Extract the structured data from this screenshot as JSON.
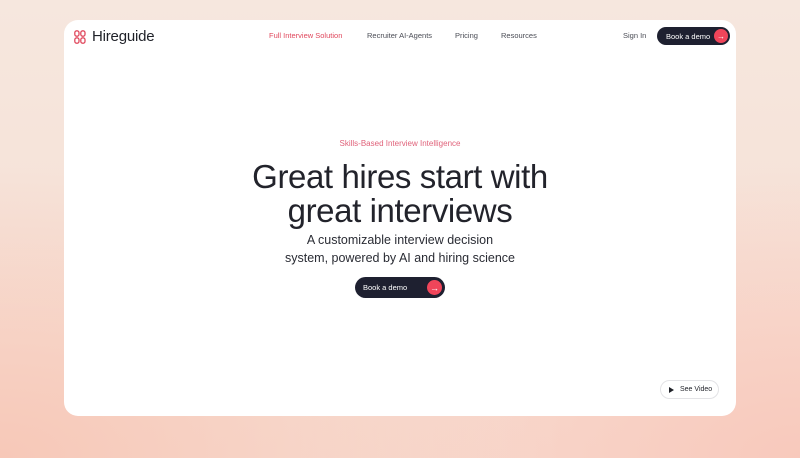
{
  "brand": {
    "name": "Hireguide",
    "accent": "#f0455a",
    "dark": "#1e2030"
  },
  "nav": {
    "links": [
      {
        "label": "Full Interview Solution",
        "active": true
      },
      {
        "label": "Recruiter AI-Agents",
        "active": false
      },
      {
        "label": "Pricing",
        "active": false
      },
      {
        "label": "Resources",
        "active": false
      }
    ],
    "sign_in": "Sign In",
    "cta": "Book a demo"
  },
  "hero": {
    "eyebrow": "Skills-Based Interview Intelligence",
    "headline_line1": "Great hires start with",
    "headline_line2": "great interviews",
    "subhead_line1": "A customizable interview decision",
    "subhead_line2": "system, powered by AI and hiring science",
    "cta": "Book a demo"
  },
  "video": {
    "label": "See Video",
    "icon": "play-icon"
  },
  "icons": {
    "arrow": "arrow-right-icon",
    "logo": "hireguide-logo-icon"
  }
}
